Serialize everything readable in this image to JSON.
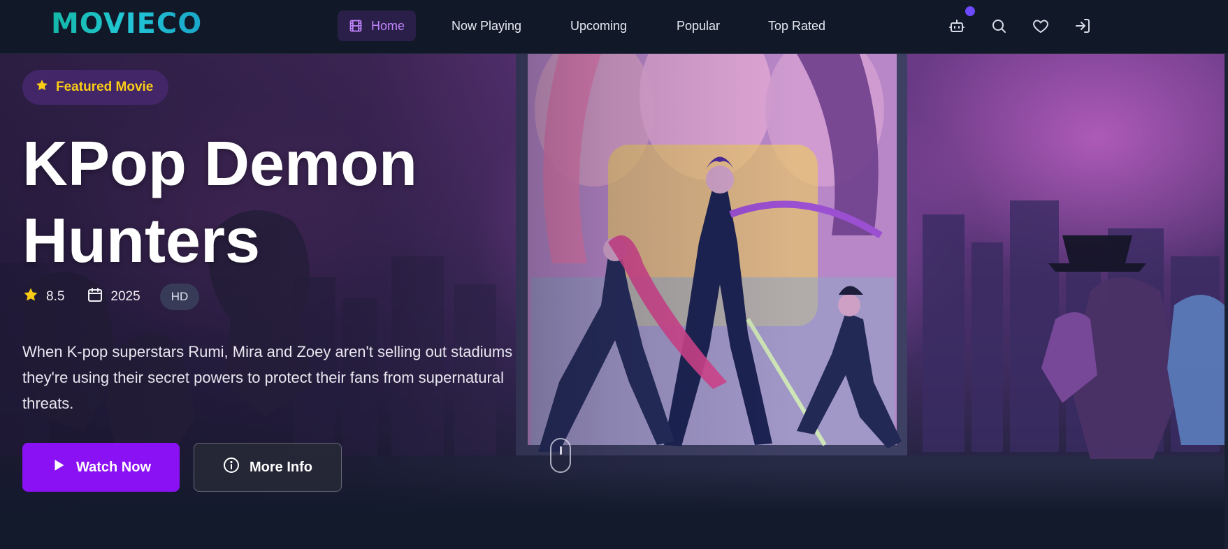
{
  "brand": {
    "logo_text": "MOVIECO"
  },
  "nav": {
    "items": [
      {
        "label": "Home",
        "icon": "film-icon",
        "active": true
      },
      {
        "label": "Now Playing"
      },
      {
        "label": "Upcoming"
      },
      {
        "label": "Popular"
      },
      {
        "label": "Top Rated"
      }
    ],
    "actions": [
      "robot-icon",
      "search-icon",
      "heart-icon",
      "login-icon"
    ]
  },
  "hero": {
    "badge": "Featured Movie",
    "title_line1": "KPop Demon",
    "title_line2": "Hunters",
    "rating": "8.5",
    "year": "2025",
    "quality": "HD",
    "description": "When K-pop superstars Rumi, Mira and Zoey aren't selling out stadiums they're using their secret powers to protect their fans from supernatural threats.",
    "primary_button": "Watch Now",
    "secondary_button": "More Info"
  },
  "colors": {
    "accent": "#8b11f5",
    "active_nav": "#c084fc",
    "star": "#facc15",
    "logo_gradient": [
      "#14b8a6",
      "#1aa6c9"
    ],
    "background": "#131a2c"
  }
}
